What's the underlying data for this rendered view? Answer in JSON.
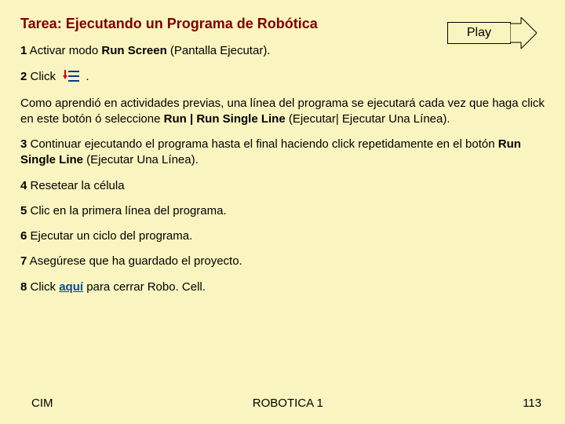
{
  "title": "Tarea: Ejecutando un Programa de Robótica",
  "play_label": "Play",
  "steps": {
    "s1": {
      "num": "1",
      "t1": " Activar modo ",
      "b1": "Run Screen",
      "t2": " (Pantalla Ejecutar)."
    },
    "s2": {
      "num": "2",
      "t1": " Click ",
      "after_icon": "."
    },
    "para1": {
      "t1": "Como aprendió en actividades previas, una línea del programa se ejecutará cada vez que haga click en este botón ó seleccione ",
      "b1": "Run | Run Single Line",
      "t2": " (Ejecutar| Ejecutar Una Línea)."
    },
    "s3": {
      "num": "3",
      "t1": " Continuar ejecutando el programa hasta el final haciendo click repetidamente en el botón ",
      "b1": "Run Single Line",
      "t2": " (Ejecutar Una Línea)."
    },
    "s4": {
      "num": "4",
      "t1": " Resetear la célula"
    },
    "s5": {
      "num": "5",
      "t1": " Clic en la primera línea del programa."
    },
    "s6": {
      "num": "6",
      "t1": " Ejecutar un ciclo del programa."
    },
    "s7": {
      "num": "7",
      "t1": " Asegúrese que ha guardado el proyecto."
    },
    "s8": {
      "num": "8",
      "t1": " Click ",
      "link": "aquí",
      "t2": " para cerrar Robo. Cell."
    }
  },
  "footer": {
    "left": "CIM",
    "center": "ROBOTICA 1",
    "right": "113"
  }
}
